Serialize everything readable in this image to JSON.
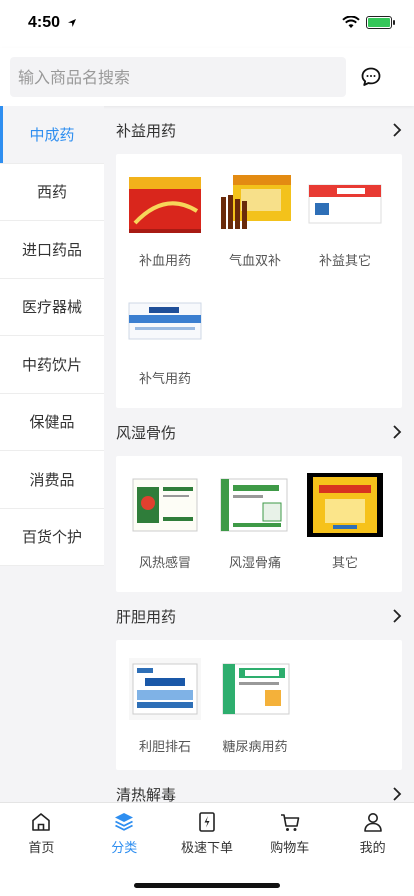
{
  "status_bar": {
    "time": "4:50"
  },
  "search": {
    "placeholder": "输入商品名搜索"
  },
  "sidebar": {
    "items": [
      {
        "label": "中成药"
      },
      {
        "label": "西药"
      },
      {
        "label": "进口药品"
      },
      {
        "label": "医疗器械"
      },
      {
        "label": "中药饮片"
      },
      {
        "label": "保健品"
      },
      {
        "label": "消费品"
      },
      {
        "label": "百货个护"
      }
    ],
    "active_index": 0
  },
  "sections": [
    {
      "title": "补益用药",
      "products": [
        {
          "label": "补血用药",
          "image": "red-gold-medicine-box"
        },
        {
          "label": "气血双补",
          "image": "oral-liquid-box"
        },
        {
          "label": "补益其它",
          "image": "red-white-medicine-box"
        },
        {
          "label": "补气用药",
          "image": "blue-white-medicine-box"
        }
      ]
    },
    {
      "title": "风湿骨伤",
      "products": [
        {
          "label": "风热感冒",
          "image": "green-granule-box"
        },
        {
          "label": "风湿骨痛",
          "image": "green-white-granule-box"
        },
        {
          "label": "其它",
          "image": "yellow-ointment-box"
        }
      ]
    },
    {
      "title": "肝胆用药",
      "products": [
        {
          "label": "利胆排石",
          "image": "gancao-granule-box"
        },
        {
          "label": "糖尿病用药",
          "image": "capsule-box"
        }
      ]
    },
    {
      "title": "清热解毒",
      "products": []
    }
  ],
  "tab_bar": {
    "tabs": [
      {
        "label": "首页",
        "icon": "home-icon"
      },
      {
        "label": "分类",
        "icon": "layers-icon"
      },
      {
        "label": "极速下单",
        "icon": "quick-order-icon"
      },
      {
        "label": "购物车",
        "icon": "cart-icon"
      },
      {
        "label": "我的",
        "icon": "user-icon"
      }
    ],
    "active_index": 1
  },
  "colors": {
    "accent": "#2e8ef0",
    "background": "#f4f4f6"
  }
}
